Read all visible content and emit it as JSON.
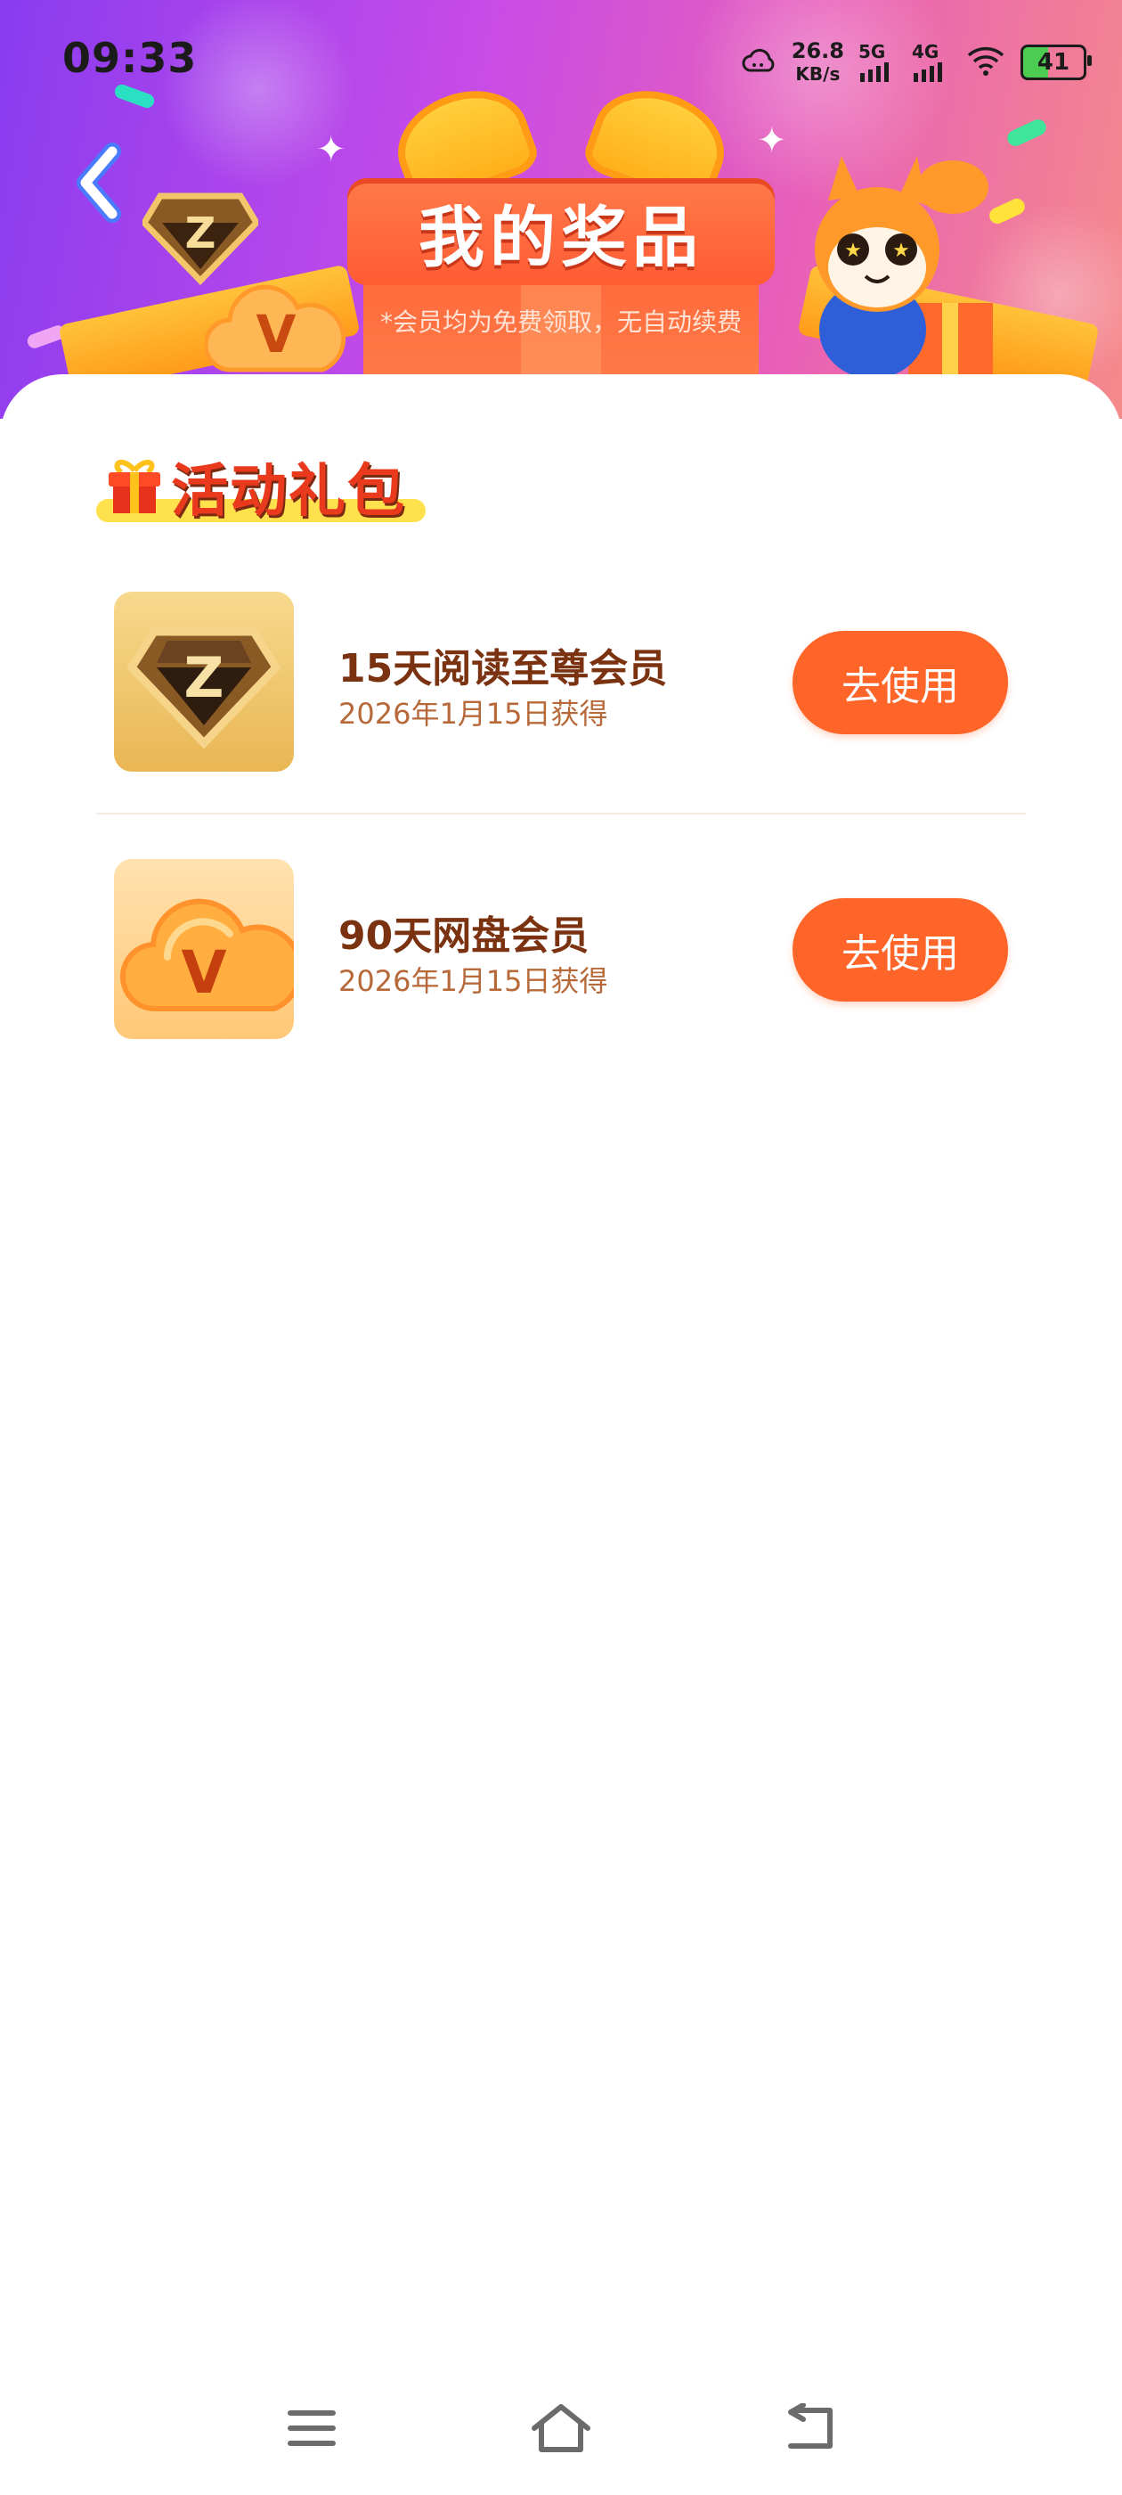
{
  "status_bar": {
    "time": "09:33",
    "net_speed_value": "26.8",
    "net_speed_unit": "KB/s",
    "sim1_label": "5G",
    "sim2_label": "4G",
    "battery_level": "41"
  },
  "header": {
    "title": "我的奖品",
    "subtitle": "*会员均为免费领取，无自动续费"
  },
  "section": {
    "title": "活动礼包"
  },
  "prizes": [
    {
      "name": "15天阅读至尊会员",
      "date": "2026年1月15日获得",
      "button_label": "去使用",
      "icon": "z-diamond-icon"
    },
    {
      "name": "90天网盘会员",
      "date": "2026年1月15日获得",
      "button_label": "去使用",
      "icon": "v-cloud-icon"
    }
  ],
  "colors": {
    "accent": "#ff6428",
    "title_red": "#e93a1d",
    "name_brown": "#7a3211",
    "date_brown": "#b7693a"
  }
}
